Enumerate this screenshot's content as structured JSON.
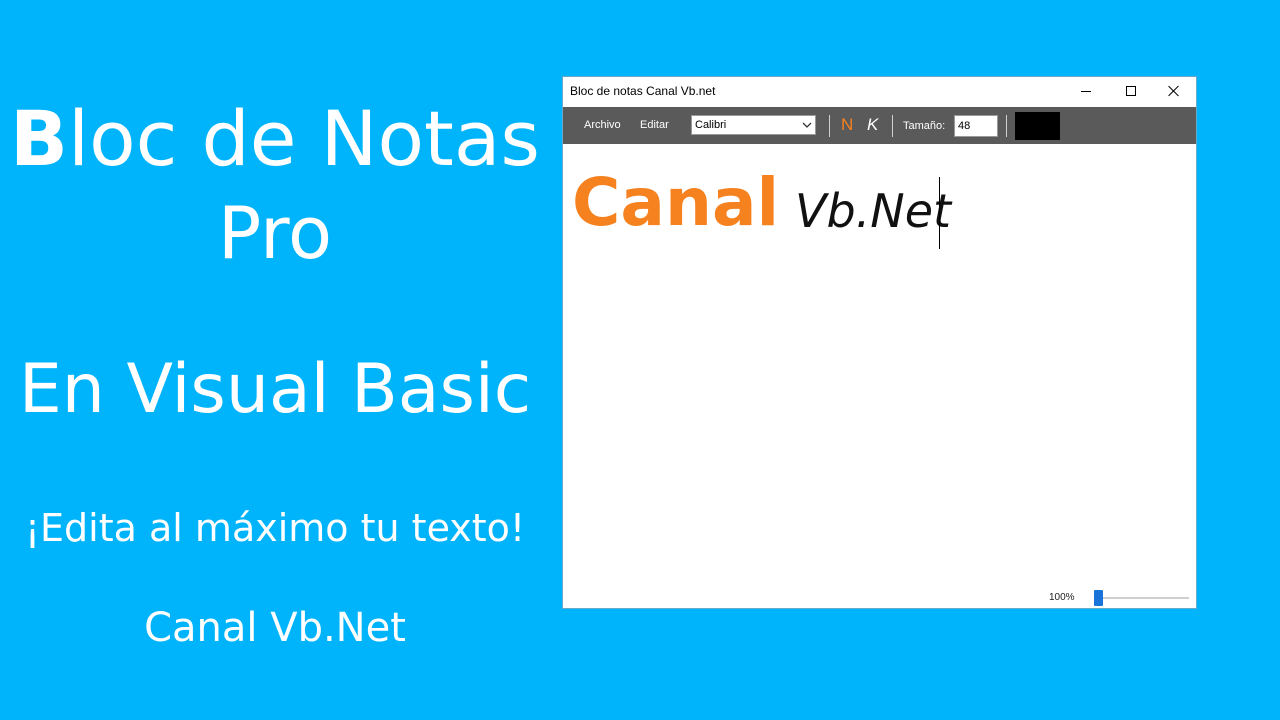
{
  "promo": {
    "title_first_letter": "B",
    "title_rest": "loc de Notas",
    "title_line2": "Pro",
    "subtitle": "En Visual Basic",
    "tagline": "¡Edita al máximo tu texto!",
    "channel": "Canal Vb.Net"
  },
  "window": {
    "title": "Bloc de notas Canal Vb.net",
    "controls": [
      "minimize-icon",
      "maximize-icon",
      "close-icon"
    ]
  },
  "toolbar": {
    "menu_archivo": "Archivo",
    "menu_editar": "Editar",
    "font_value": "Calibri",
    "bold_label": "N",
    "italic_label": "K",
    "size_label": "Tamaño:",
    "size_value": "48",
    "color_value": "#000000",
    "bold_color": "#f5821f"
  },
  "editor": {
    "text_part1": "Canal",
    "text_part2": "Vb.Net"
  },
  "status": {
    "zoom_label": "100%",
    "zoom_fraction": 0.0
  },
  "colors": {
    "background": "#00b4fc",
    "toolbar": "#5a5a5a",
    "accent_orange": "#f5821f",
    "slider_thumb": "#1a73d9"
  }
}
